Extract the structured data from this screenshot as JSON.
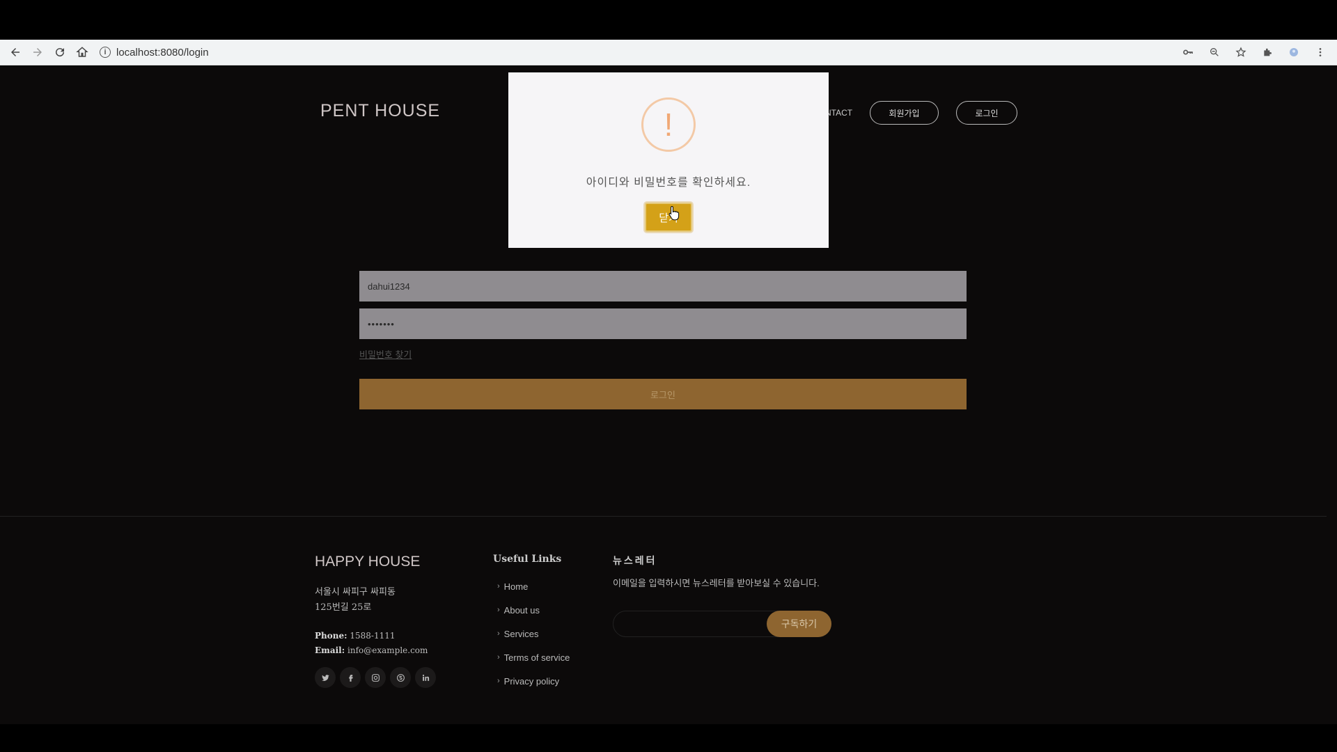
{
  "browser": {
    "url": "localhost:8080/login"
  },
  "header": {
    "logo": "PENT HOUSE",
    "nav_contact": "NTACT",
    "signup_label": "회원가입",
    "login_label": "로그인"
  },
  "login_form": {
    "id_value": "dahui1234",
    "password_value": "•••••••",
    "find_password": "비밀번호 찾기",
    "submit_label": "로그인"
  },
  "modal": {
    "icon": "!",
    "message": "아이디와 비밀번호를 확인하세요.",
    "close_label": "닫기"
  },
  "footer": {
    "title": "HAPPY HOUSE",
    "address_line1": "서울시 싸피구 싸피동",
    "address_line2": "125번길 25로",
    "phone_label": "Phone:",
    "phone": "1588-1111",
    "email_label": "Email:",
    "email": "info@example.com",
    "links_title": "Useful Links",
    "links": [
      "Home",
      "About us",
      "Services",
      "Terms of service",
      "Privacy policy"
    ],
    "newsletter_title": "뉴스레터",
    "newsletter_desc": "이메일을 입력하시면 뉴스레터를 받아보실 수 있습니다.",
    "subscribe_label": "구독하기"
  },
  "colors": {
    "accent": "#8e6530",
    "modal_button": "#d4a118",
    "warning": "#f0a875"
  }
}
